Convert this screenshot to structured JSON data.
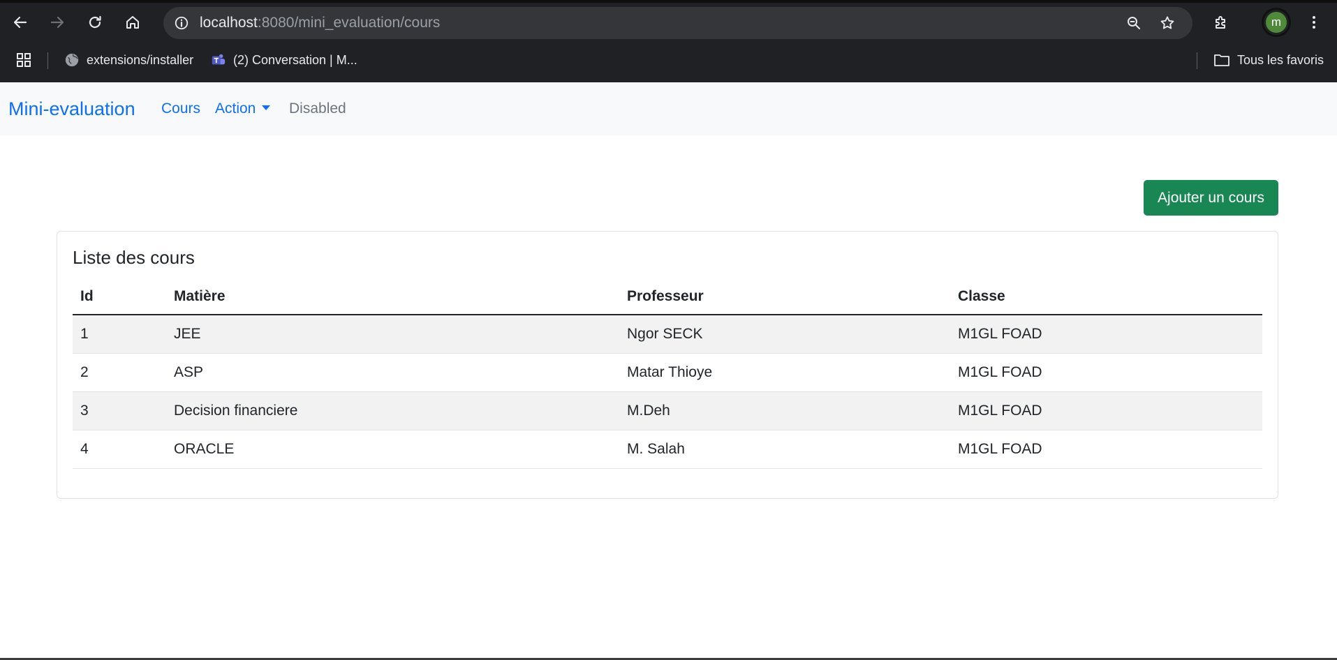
{
  "browser": {
    "url_host": "localhost",
    "url_path": ":8080/mini_evaluation/cours",
    "profile_initial": "m",
    "bookmarks": [
      {
        "label": "extensions/installer"
      },
      {
        "label": "(2) Conversation | M..."
      }
    ],
    "all_bookmarks_label": "Tous les favoris"
  },
  "navbar": {
    "brand": "Mini-evaluation",
    "links": [
      {
        "label": "Cours"
      },
      {
        "label": "Action"
      },
      {
        "label": "Disabled"
      }
    ]
  },
  "main": {
    "add_button_label": "Ajouter un cours",
    "card_title": "Liste des cours",
    "table": {
      "headers": [
        "Id",
        "Matière",
        "Professeur",
        "Classe"
      ],
      "rows": [
        [
          "1",
          "JEE",
          "Ngor SECK",
          "M1GL FOAD"
        ],
        [
          "2",
          "ASP",
          "Matar Thioye",
          "M1GL FOAD"
        ],
        [
          "3",
          "Decision financiere",
          "M.Deh",
          "M1GL FOAD"
        ],
        [
          "4",
          "ORACLE",
          "M. Salah",
          "M1GL FOAD"
        ]
      ]
    }
  },
  "colors": {
    "chrome_bg": "#202124",
    "omnibox_bg": "#35363a",
    "link": "#0d6efd",
    "success": "#198754",
    "navbar_bg": "#f8f9fa",
    "stripe": "#f2f2f2"
  }
}
